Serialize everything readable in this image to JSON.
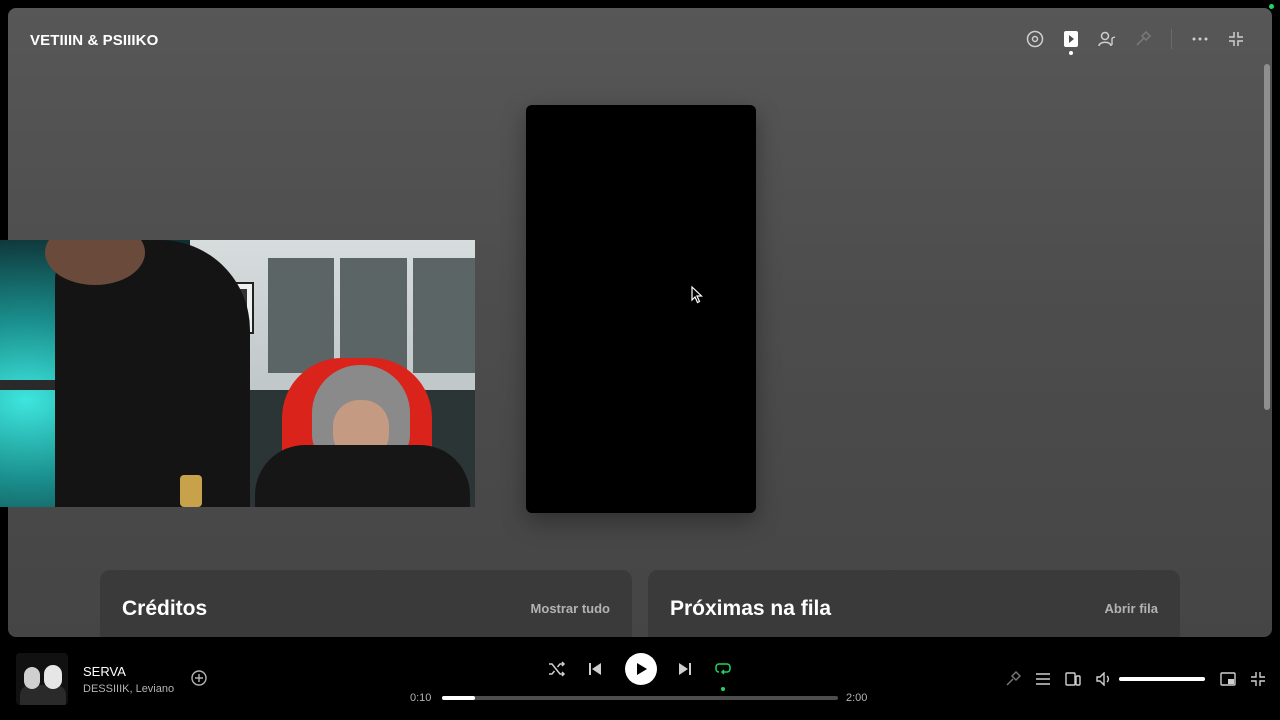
{
  "header": {
    "title": "VETIIIN & PSIIIKO",
    "icons": [
      "disc-icon",
      "now-playing-view-icon",
      "artist-icon",
      "lyrics-icon",
      "more-icon",
      "minimize-icon"
    ]
  },
  "cards": {
    "credits": {
      "title": "Créditos",
      "link": "Mostrar tudo"
    },
    "queue": {
      "title": "Próximas na fila",
      "link": "Abrir fila"
    }
  },
  "player": {
    "track": "SERVA",
    "artists": "DESSIIIK, Leviano",
    "elapsed": "0:10",
    "duration": "2:00",
    "progress_fraction": 0.083,
    "volume_fraction": 1.0,
    "repeat_active": true,
    "accent": "#1ed760"
  }
}
